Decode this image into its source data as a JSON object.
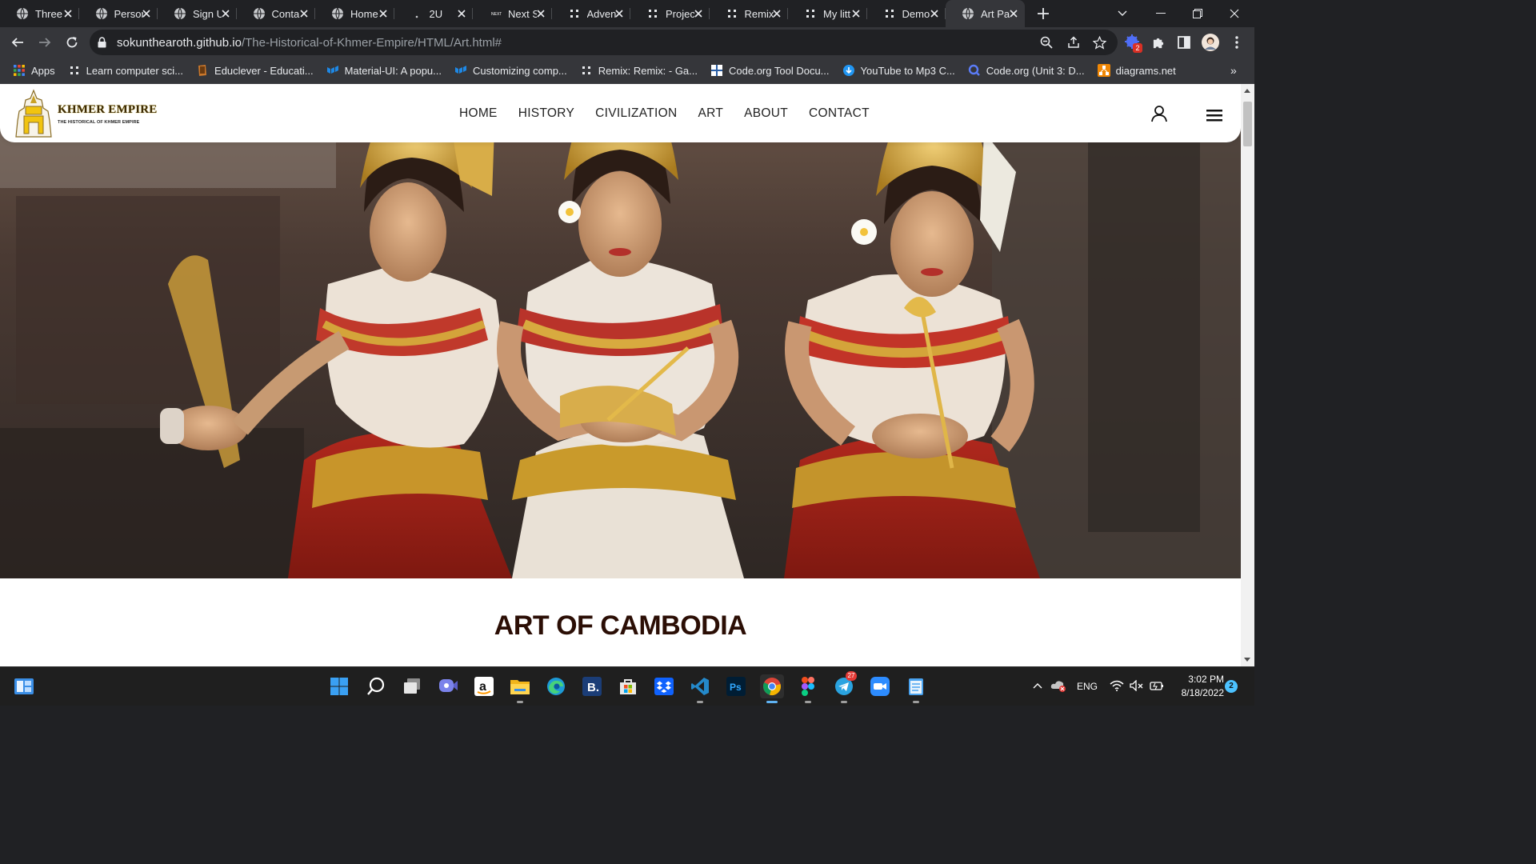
{
  "browser": {
    "tabs": [
      {
        "label": "Three",
        "icon": "globe-icon"
      },
      {
        "label": "Person",
        "icon": "globe-icon"
      },
      {
        "label": "Sign U",
        "icon": "globe-icon"
      },
      {
        "label": "Conta",
        "icon": "globe-icon"
      },
      {
        "label": "Home",
        "icon": "globe-icon"
      },
      {
        "label": "2U",
        "icon": "dot-icon"
      },
      {
        "label": "Next S",
        "icon": "next-icon"
      },
      {
        "label": "Adven",
        "icon": "dots-icon"
      },
      {
        "label": "Projec",
        "icon": "dots-icon"
      },
      {
        "label": "Remix",
        "icon": "dots-icon"
      },
      {
        "label": "My litt",
        "icon": "dots-icon"
      },
      {
        "label": "Demo",
        "icon": "dots-icon"
      },
      {
        "label": "Art Pa",
        "icon": "globe-icon",
        "active": true
      }
    ],
    "url_host": "sokunthearoth.github.io",
    "url_path": "/The-Historical-of-Khmer-Empire/HTML/Art.html#",
    "extension_badge": "2",
    "bookmarks": [
      {
        "label": "Apps",
        "icon": "apps-grid-icon"
      },
      {
        "label": "Learn computer sci...",
        "icon": "dots-icon"
      },
      {
        "label": "Educlever - Educati...",
        "icon": "book-icon"
      },
      {
        "label": "Material-UI: A popu...",
        "icon": "mui-icon"
      },
      {
        "label": "Customizing comp...",
        "icon": "mui-icon"
      },
      {
        "label": "Remix: Remix: - Ga...",
        "icon": "dots-icon"
      },
      {
        "label": "Code.org Tool Docu...",
        "icon": "codeorg-icon"
      },
      {
        "label": "YouTube to Mp3 C...",
        "icon": "download-icon"
      },
      {
        "label": "Code.org (Unit 3: D...",
        "icon": "search-q-icon"
      },
      {
        "label": "diagrams.net",
        "icon": "diagrams-icon"
      }
    ]
  },
  "site": {
    "logo_title": "KHMER EMPIRE",
    "logo_subtitle": "THE HISTORICAL OF KHMER EMPIRE",
    "nav": [
      "HOME",
      "HISTORY",
      "CIVILIZATION",
      "ART",
      "ABOUT",
      "CONTACT"
    ],
    "section_title": "ART OF CAMBODIA"
  },
  "taskbar": {
    "telegram_badge": "27",
    "language": "ENG",
    "time": "3:02 PM",
    "date": "8/18/2022",
    "notification_count": "2"
  }
}
